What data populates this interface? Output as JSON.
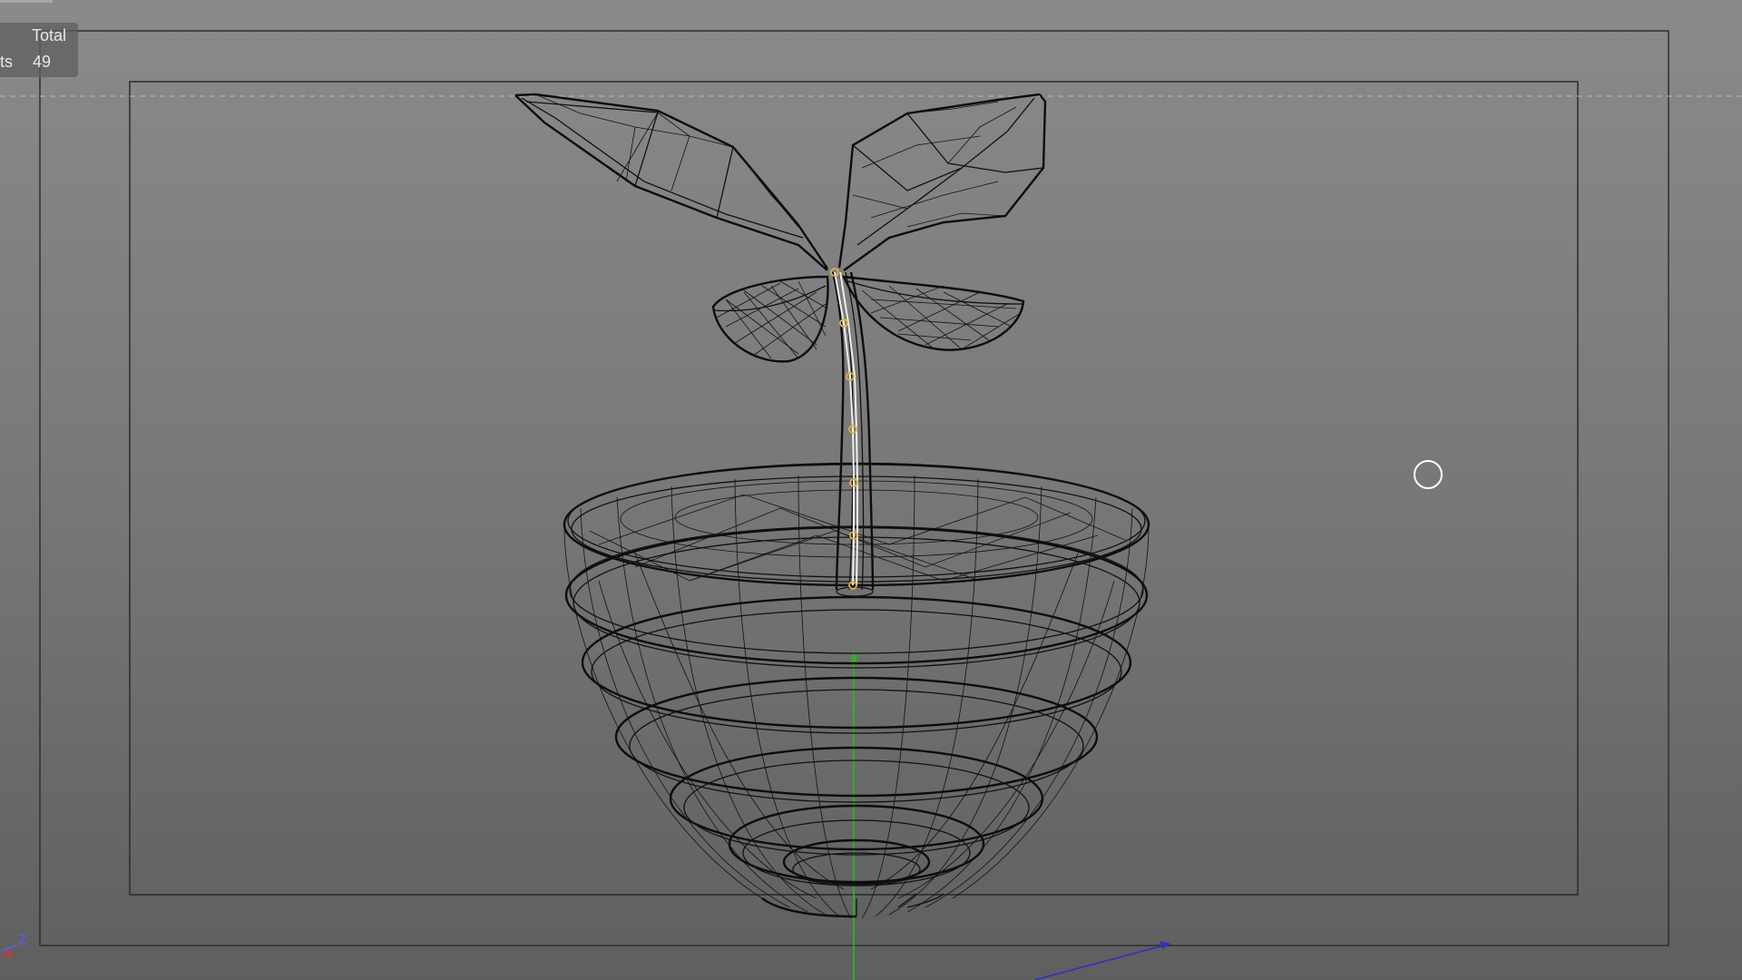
{
  "stats": {
    "header": "Total",
    "row_label": "ts",
    "row_value": "49"
  },
  "axis_gizmo": {
    "z_label": "Z",
    "x_label": "X",
    "z_color": "#5a5aff",
    "x_color": "#e03030"
  },
  "colors": {
    "viewport_top": "#8a8a8a",
    "viewport_bottom": "#5f5f5f",
    "wireframe": "#111111",
    "joint": "#e0b040",
    "y_axis": "#20c020",
    "x_axis": "#3030c0",
    "frame_border": "#2a2a2a"
  },
  "viewport": {
    "display_mode": "wireframe",
    "object": "seedling-in-pot"
  }
}
